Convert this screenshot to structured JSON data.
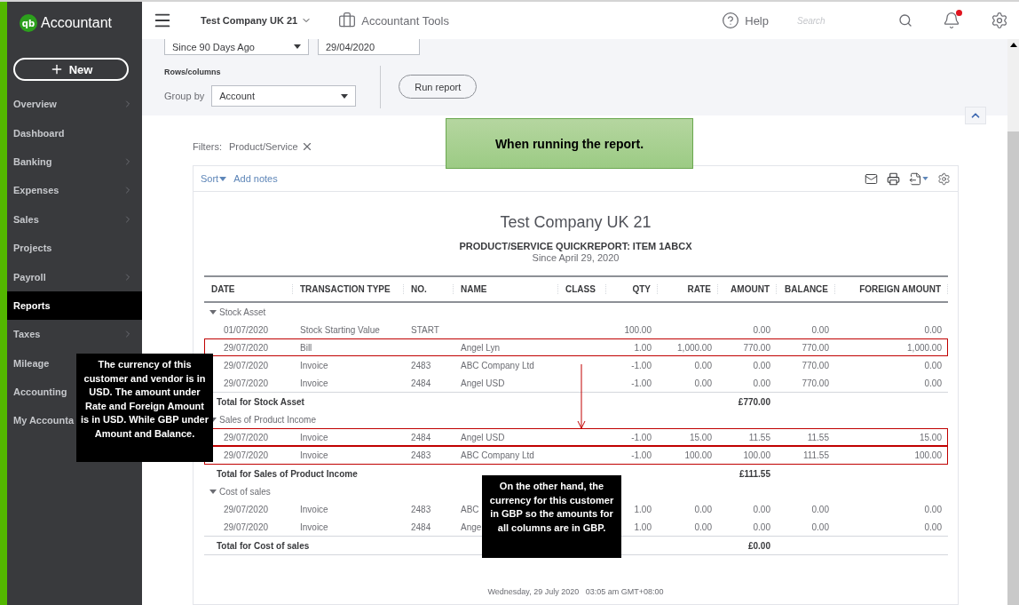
{
  "brand": {
    "logo": "qb",
    "name": "Accountant"
  },
  "new_button": {
    "label": "New"
  },
  "sidebar": {
    "items": [
      {
        "label": "Overview",
        "has_submenu": true,
        "selected": false
      },
      {
        "label": "Dashboard",
        "has_submenu": false,
        "selected": false
      },
      {
        "label": "Banking",
        "has_submenu": true,
        "selected": false
      },
      {
        "label": "Expenses",
        "has_submenu": true,
        "selected": false
      },
      {
        "label": "Sales",
        "has_submenu": true,
        "selected": false
      },
      {
        "label": "Projects",
        "has_submenu": false,
        "selected": false
      },
      {
        "label": "Payroll",
        "has_submenu": true,
        "selected": false
      },
      {
        "label": "Reports",
        "has_submenu": false,
        "selected": true
      },
      {
        "label": "Taxes",
        "has_submenu": true,
        "selected": false
      },
      {
        "label": "Mileage",
        "has_submenu": false,
        "selected": false
      },
      {
        "label": "Accounting",
        "has_submenu": false,
        "selected": false
      },
      {
        "label": "My Accounta",
        "has_submenu": false,
        "selected": false
      }
    ]
  },
  "top_bar": {
    "company": "Test Company UK 21",
    "tools": "Accountant Tools",
    "help": "Help",
    "search": {
      "placeholder": "Search"
    },
    "notification": true
  },
  "controls": {
    "period": "Since 90 Days Ago",
    "date": "29/04/2020",
    "rows_columns_label": "Rows/columns",
    "group_by_label": "Group by",
    "group_by": "Account",
    "run_button": "Run report"
  },
  "filters": {
    "label": "Filters:",
    "items": [
      "Product/Service"
    ]
  },
  "report_toolbar": {
    "sort": "Sort",
    "add_notes": "Add notes"
  },
  "report": {
    "company": "Test Company UK 21",
    "title": "PRODUCT/SERVICE QUICKREPORT: ITEM 1ABCX",
    "period": "Since April 29, 2020",
    "columns": [
      "DATE",
      "TRANSACTION TYPE",
      "NO.",
      "NAME",
      "CLASS",
      "QTY",
      "RATE",
      "AMOUNT",
      "BALANCE",
      "FOREIGN AMOUNT"
    ],
    "rows": [
      {
        "kind": "group",
        "label": "Stock Asset",
        "expanded": true
      },
      {
        "kind": "row",
        "cells": [
          "01/07/2020",
          "Stock Starting Value",
          "START",
          "",
          "",
          "100.00",
          "",
          "0.00",
          "0.00",
          "0.00"
        ],
        "highlighted": false
      },
      {
        "kind": "row",
        "cells": [
          "29/07/2020",
          "Bill",
          "",
          "Angel Lyn",
          "",
          "1.00",
          "1,000.00",
          "770.00",
          "770.00",
          "1,000.00"
        ],
        "highlighted": true
      },
      {
        "kind": "row",
        "cells": [
          "29/07/2020",
          "Invoice",
          "2483",
          "ABC Company Ltd",
          "",
          "-1.00",
          "0.00",
          "0.00",
          "770.00",
          "0.00"
        ],
        "highlighted": false
      },
      {
        "kind": "row",
        "cells": [
          "29/07/2020",
          "Invoice",
          "2484",
          "Angel USD",
          "",
          "-1.00",
          "0.00",
          "0.00",
          "770.00",
          "0.00"
        ],
        "highlighted": false
      },
      {
        "kind": "total",
        "label": "Total for Stock Asset",
        "amount": "£770.00"
      },
      {
        "kind": "group",
        "label": "Sales of Product Income",
        "expanded": true
      },
      {
        "kind": "row",
        "cells": [
          "29/07/2020",
          "Invoice",
          "2484",
          "Angel USD",
          "",
          "-1.00",
          "15.00",
          "11.55",
          "11.55",
          "15.00"
        ],
        "highlighted": true
      },
      {
        "kind": "row",
        "cells": [
          "29/07/2020",
          "Invoice",
          "2483",
          "ABC Company Ltd",
          "",
          "-1.00",
          "100.00",
          "100.00",
          "111.55",
          "100.00"
        ],
        "highlighted": true
      },
      {
        "kind": "total",
        "label": "Total for Sales of Product Income",
        "amount": "£111.55"
      },
      {
        "kind": "group",
        "label": "Cost of sales",
        "expanded": true
      },
      {
        "kind": "row",
        "cells": [
          "29/07/2020",
          "Invoice",
          "2483",
          "ABC",
          "",
          "1.00",
          "0.00",
          "0.00",
          "0.00",
          "0.00"
        ],
        "highlighted": false
      },
      {
        "kind": "row",
        "cells": [
          "29/07/2020",
          "Invoice",
          "2484",
          "Ange",
          "",
          "1.00",
          "0.00",
          "0.00",
          "0.00",
          "0.00"
        ],
        "highlighted": false
      },
      {
        "kind": "total",
        "label": "Total for Cost of sales",
        "amount": "£0.00"
      }
    ],
    "footer": "Wednesday, 29 July 2020   03:05 am GMT+08:00"
  },
  "annotations": [
    {
      "kind": "banner",
      "text": "When running the report."
    },
    {
      "kind": "note",
      "text": "The currency of this customer and vendor is in USD.  The amount under Rate and Foreign Amount is in USD.  While GBP under Amount and Balance."
    },
    {
      "kind": "note",
      "text": "On the other hand, the currency for this customer in GBP so the amounts for all columns are in GBP."
    }
  ]
}
